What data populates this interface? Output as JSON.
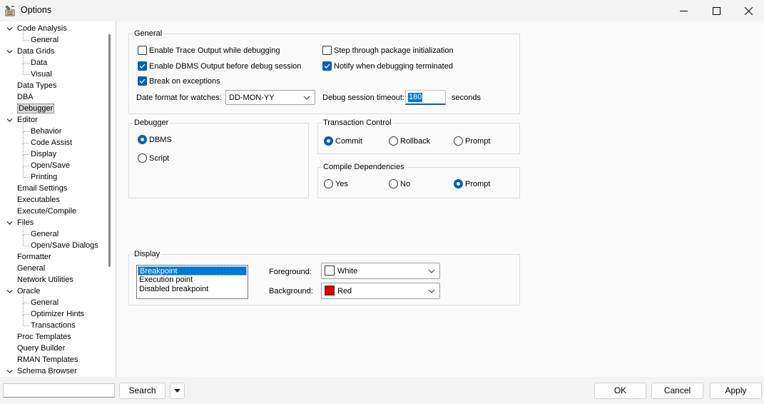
{
  "window": {
    "title": "Options"
  },
  "tree": {
    "items": [
      {
        "label": "Code Analysis",
        "expanded": true
      },
      {
        "label": "General"
      },
      {
        "label": "Data Grids",
        "expanded": true
      },
      {
        "label": "Data"
      },
      {
        "label": "Visual"
      },
      {
        "label": "Data Types"
      },
      {
        "label": "DBA"
      },
      {
        "label": "Debugger",
        "selected": true
      },
      {
        "label": "Editor",
        "expanded": true
      },
      {
        "label": "Behavior"
      },
      {
        "label": "Code Assist"
      },
      {
        "label": "Display"
      },
      {
        "label": "Open/Save"
      },
      {
        "label": "Printing"
      },
      {
        "label": "Email Settings"
      },
      {
        "label": "Executables"
      },
      {
        "label": "Execute/Compile"
      },
      {
        "label": "Files",
        "expanded": true
      },
      {
        "label": "General"
      },
      {
        "label": "Open/Save Dialogs"
      },
      {
        "label": "Formatter"
      },
      {
        "label": "General"
      },
      {
        "label": "Network Utilities"
      },
      {
        "label": "Oracle",
        "expanded": true
      },
      {
        "label": "General"
      },
      {
        "label": "Optimizer Hints"
      },
      {
        "label": "Transactions"
      },
      {
        "label": "Proc Templates"
      },
      {
        "label": "Query Builder"
      },
      {
        "label": "RMAN Templates"
      },
      {
        "label": "Schema Browser",
        "expanded": true
      }
    ]
  },
  "general": {
    "title": "General",
    "enable_trace": {
      "label": "Enable Trace Output while debugging",
      "checked": false
    },
    "enable_dbms": {
      "label": "Enable DBMS Output before debug session",
      "checked": true
    },
    "break_exceptions": {
      "label": "Break on exceptions",
      "checked": true
    },
    "step_through": {
      "label": "Step through package initialization",
      "checked": false
    },
    "notify_terminated": {
      "label": "Notify when debugging terminated",
      "checked": true
    },
    "date_format_label": "Date format for watches:",
    "date_format_value": "DD-MON-YY",
    "timeout_label": "Debug session timeout:",
    "timeout_value": "180",
    "timeout_unit": "seconds"
  },
  "debugger": {
    "title": "Debugger",
    "dbms": {
      "label": "DBMS",
      "checked": true
    },
    "script": {
      "label": "Script",
      "checked": false
    }
  },
  "transaction_control": {
    "title": "Transaction Control",
    "commit": {
      "label": "Commit",
      "checked": true
    },
    "rollback": {
      "label": "Rollback",
      "checked": false
    },
    "prompt": {
      "label": "Prompt",
      "checked": false
    }
  },
  "compile_dependencies": {
    "title": "Compile Dependencies",
    "yes": {
      "label": "Yes",
      "checked": false
    },
    "no": {
      "label": "No",
      "checked": false
    },
    "prompt": {
      "label": "Prompt",
      "checked": true
    }
  },
  "display": {
    "title": "Display",
    "list": [
      "Breakpoint",
      "Execution point",
      "Disabled breakpoint"
    ],
    "foreground_label": "Foreground:",
    "foreground_value": "White",
    "foreground_color": "#ffffff",
    "background_label": "Background:",
    "background_value": "Red",
    "background_color": "#e00000"
  },
  "bottom": {
    "search_value": "",
    "search_button": "Search",
    "dropdown_icon": "chevron-down-icon",
    "ok": "OK",
    "cancel": "Cancel",
    "apply": "Apply"
  },
  "colors": {
    "accent": "#005fb8"
  }
}
